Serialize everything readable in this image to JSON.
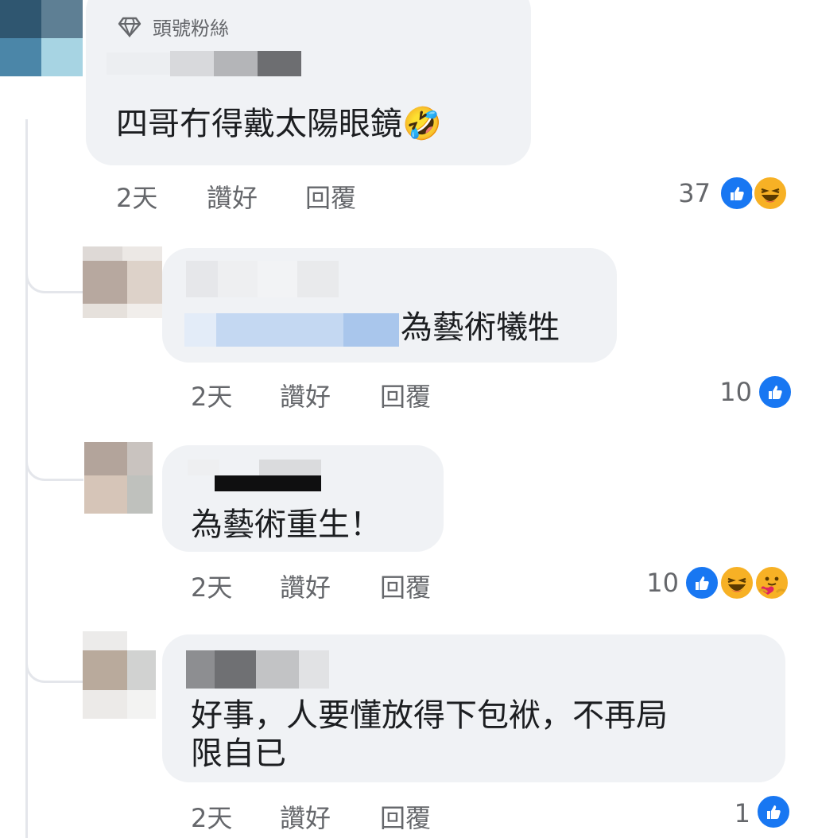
{
  "comments": [
    {
      "badge": "頭號粉絲",
      "text": "四哥冇得戴太陽眼鏡🤣",
      "time": "2天",
      "like_label": "讚好",
      "reply_label": "回覆",
      "reaction_count": "37",
      "reactions": [
        "like-icon",
        "haha-icon"
      ]
    },
    {
      "text": "為藝術犧牲",
      "time": "2天",
      "like_label": "讚好",
      "reply_label": "回覆",
      "reaction_count": "10",
      "reactions": [
        "like-icon"
      ]
    },
    {
      "text": "為藝術重生！",
      "time": "2天",
      "like_label": "讚好",
      "reply_label": "回覆",
      "reaction_count": "10",
      "reactions": [
        "like-icon",
        "haha-icon",
        "care-icon"
      ]
    },
    {
      "text_line1": "好事，人要懂放得下包袱，不再局",
      "text_line2": "限自已",
      "time": "2天",
      "like_label": "讚好",
      "reply_label": "回覆",
      "reaction_count": "1",
      "reactions": [
        "like-icon"
      ]
    }
  ],
  "colors": {
    "bubble": "#f0f2f5",
    "like_blue": "#1877f2",
    "haha_yellow": "#f7b125",
    "meta_gray": "#65676b"
  }
}
